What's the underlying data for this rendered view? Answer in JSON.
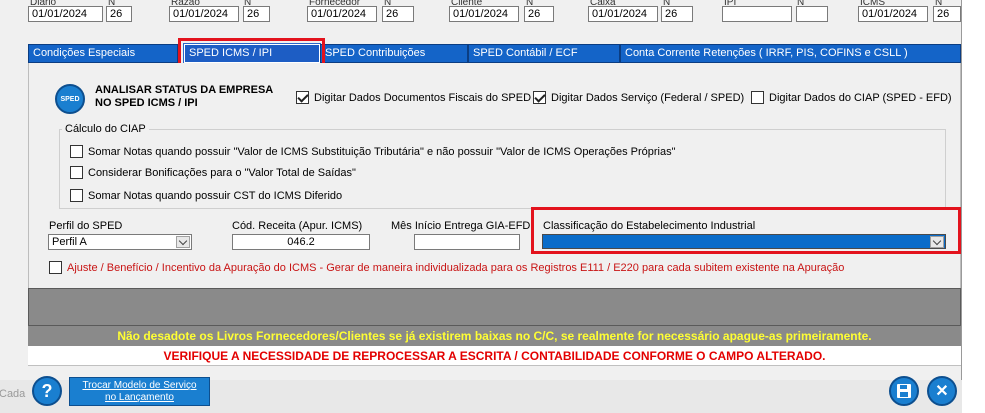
{
  "top_fields": [
    {
      "label": "Diário",
      "date": "01/01/2024",
      "n_label": "N",
      "n": "26"
    },
    {
      "label": "Razão",
      "date": "01/01/2024",
      "n_label": "N",
      "n": "26"
    },
    {
      "label": "Fornecedor",
      "date": "01/01/2024",
      "n_label": "N",
      "n": "26"
    },
    {
      "label": "Cliente",
      "date": "01/01/2024",
      "n_label": "N",
      "n": "26"
    },
    {
      "label": "Caixa",
      "date": "01/01/2024",
      "n_label": "N",
      "n": "26"
    },
    {
      "label": "IPI",
      "date": "",
      "n_label": "N",
      "n": ""
    },
    {
      "label": "ICMS",
      "date": "01/01/2024",
      "n_label": "N",
      "n": "26"
    }
  ],
  "tabs": [
    {
      "label": "Condições Especiais"
    },
    {
      "label": "SPED ICMS / IPI"
    },
    {
      "label": "SPED Contribuições"
    },
    {
      "label": "SPED Contábil / ECF"
    },
    {
      "label": "Conta Corrente Retenções ( IRRF,  PIS,  COFINS  e  CSLL )"
    }
  ],
  "status": {
    "icon": "sped-icon",
    "icon_text": "SPED",
    "title_line1": "ANALISAR STATUS DA EMPRESA",
    "title_line2": "NO SPED ICMS / IPI"
  },
  "options": [
    {
      "label": "Digitar Dados Documentos Fiscais do SPED",
      "checked": true
    },
    {
      "label": "Digitar Dados Serviço (Federal / SPED)",
      "checked": true
    },
    {
      "label": "Digitar Dados do CIAP (SPED - EFD)",
      "checked": false
    }
  ],
  "ciap": {
    "title": "Cálculo do CIAP",
    "items": [
      {
        "label": "Somar Notas quando possuir \"Valor de ICMS Substituição Tributária\" e não possuir \"Valor de ICMS Operações Próprias\"",
        "checked": false
      },
      {
        "label": "Considerar Bonificações para o \"Valor Total de Saídas\"",
        "checked": false
      },
      {
        "label": "Somar Notas quando possuir CST do ICMS Diferido",
        "checked": false
      }
    ]
  },
  "fields": {
    "perfil_label": "Perfil do SPED",
    "perfil_value": "Perfil A",
    "receita_label": "Cód. Receita (Apur. ICMS)",
    "receita_value": "046.2",
    "mes_label": "Mês Início Entrega GIA-EFD",
    "mes_value": "",
    "classif_label": "Classificação do Estabelecimento Industrial",
    "classif_value": ""
  },
  "ajuste": {
    "label": "Ajuste / Benefício / Incentivo da Apuração do ICMS - Gerar de maneira individualizada para os Registros E111 / E220 para cada subitem existente na Apuração",
    "checked": false
  },
  "messages": {
    "warning_yellow": "Não desadote os Livros Fornecedores/Clientes se já existirem baixas no C/C, se realmente for necessário apague-as primeiramente.",
    "warning_red": "VERIFIQUE A NECESSIDADE DE REPROCESSAR A ESCRITA / CONTABILIDADE CONFORME O CAMPO ALTERADO."
  },
  "footer": {
    "help_icon": "help-icon",
    "trocar_label_line1": "Trocar Modelo de Serviço",
    "trocar_label_line2": "no Lançamento",
    "save_icon": "save-icon",
    "close_icon": "close-icon",
    "cut_text": "Cada"
  },
  "colors": {
    "tab_blue": "#1464c8",
    "highlight_red": "#e3131d",
    "classif_fill": "#0a6cc9",
    "warn_yellow": "#ffff33",
    "warn_red": "#e30000",
    "ajuste_red": "#c81414"
  }
}
